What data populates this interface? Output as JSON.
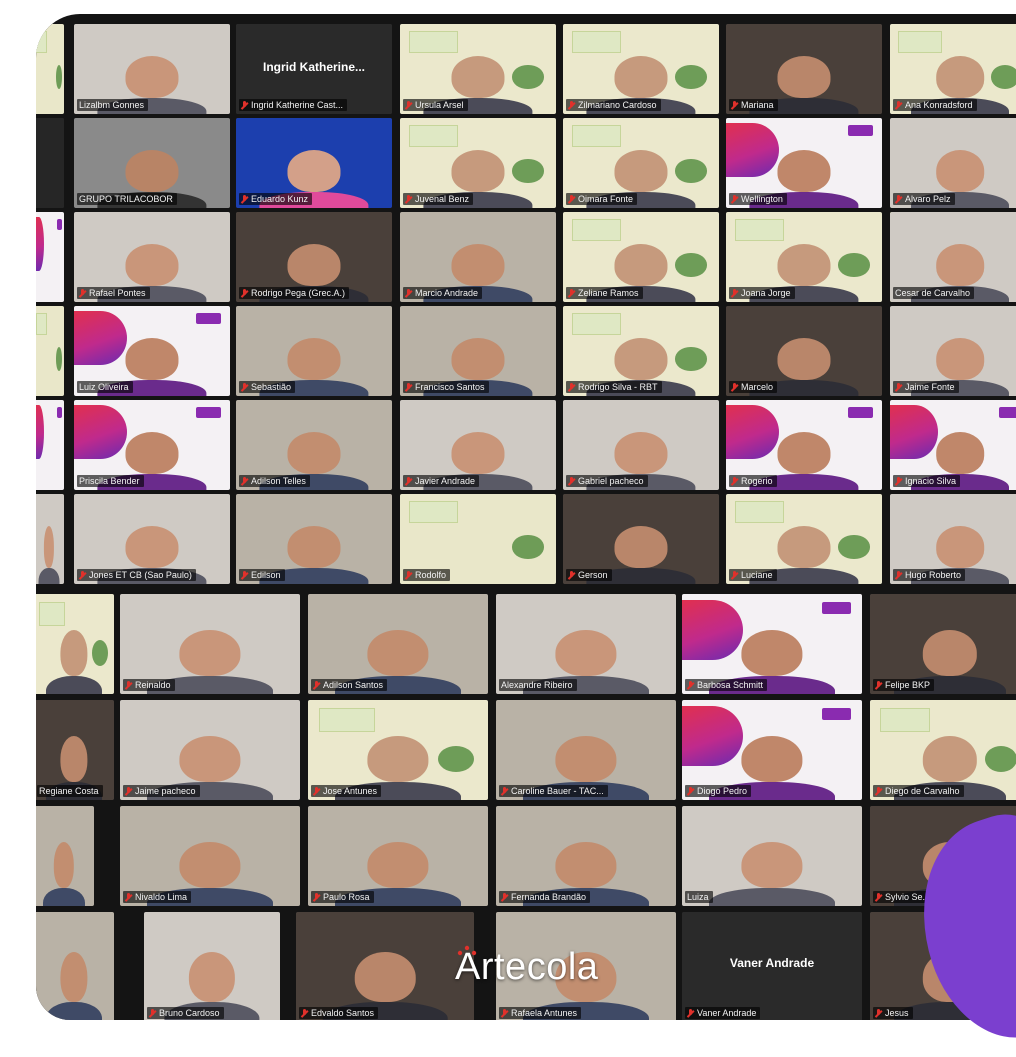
{
  "meeting": {
    "brand_text": "Artecola",
    "accent_color": "#7b3fcf",
    "muted_icon": "muted-mic-icon"
  },
  "participants": [
    {
      "name": "",
      "style": "slide",
      "muted": false
    },
    {
      "name": "Lizalbm Gonnes",
      "style": "face-light",
      "muted": false
    },
    {
      "name": "Ingrid Katherine Cast...",
      "style": "avatar",
      "muted": true,
      "big_name": "Ingrid Katherine..."
    },
    {
      "name": "Ursula Arsel",
      "style": "slide-face",
      "muted": true
    },
    {
      "name": "Zilmariano Cardoso",
      "style": "slide-face",
      "muted": true
    },
    {
      "name": "Mariana",
      "style": "face-dark",
      "muted": true
    },
    {
      "name": "Ana Konradsford",
      "style": "slide-face",
      "muted": true
    },
    {
      "name": "",
      "style": "dark",
      "muted": false
    },
    {
      "name": "GRUPO TRILACOBOR",
      "style": "group",
      "muted": false
    },
    {
      "name": "Eduardo Kunz",
      "style": "blue",
      "muted": true
    },
    {
      "name": "Juvenal Benz",
      "style": "slide-face",
      "muted": true
    },
    {
      "name": "Oimara Fonte",
      "style": "slide-face",
      "muted": true
    },
    {
      "name": "Wellington",
      "style": "art-face",
      "muted": true
    },
    {
      "name": "Alvaro Pelz",
      "style": "face-light",
      "muted": true
    },
    {
      "name": "",
      "style": "art",
      "muted": false
    },
    {
      "name": "Rafael Pontes",
      "style": "face-light",
      "muted": true
    },
    {
      "name": "Rodrigo Pega (Grec.A.)",
      "style": "face-dark",
      "muted": true
    },
    {
      "name": "Marcio Andrade",
      "style": "face-room",
      "muted": true
    },
    {
      "name": "Zeliane Ramos",
      "style": "slide-face",
      "muted": true
    },
    {
      "name": "Joana Jorge",
      "style": "slide-face",
      "muted": true
    },
    {
      "name": "Cesar de Carvalho",
      "style": "face-light",
      "muted": false,
      "speaking": true
    },
    {
      "name": "",
      "style": "slide",
      "muted": false
    },
    {
      "name": "Luiz Oliveira",
      "style": "art-face",
      "muted": false
    },
    {
      "name": "Sebastião",
      "style": "face-room",
      "muted": true
    },
    {
      "name": "Francisco Santos",
      "style": "face-room",
      "muted": true
    },
    {
      "name": "Rodrigo Silva - RBT",
      "style": "slide-face",
      "muted": true
    },
    {
      "name": "Marcelo",
      "style": "face-dark",
      "muted": true
    },
    {
      "name": "Jaime Fonte",
      "style": "face-light",
      "muted": true
    },
    {
      "name": "",
      "style": "art",
      "muted": false
    },
    {
      "name": "Priscila Bender",
      "style": "art-face",
      "muted": false
    },
    {
      "name": "Adilson Telles",
      "style": "face-room",
      "muted": true
    },
    {
      "name": "Javier Andrade",
      "style": "face-light",
      "muted": true
    },
    {
      "name": "Gabriel pacheco",
      "style": "face-light",
      "muted": true
    },
    {
      "name": "Rogerio",
      "style": "art-face",
      "muted": true
    },
    {
      "name": "Ignacio Silva",
      "style": "art-face",
      "muted": true
    },
    {
      "name": "",
      "style": "face-light",
      "muted": false
    },
    {
      "name": "Jones ET CB (Sao Paulo)",
      "style": "face-light",
      "muted": true
    },
    {
      "name": "Edilson",
      "style": "face-room",
      "muted": true
    },
    {
      "name": "Rodolfo",
      "style": "slide",
      "muted": true
    },
    {
      "name": "Gerson",
      "style": "face-dark",
      "muted": true
    },
    {
      "name": "Luciane",
      "style": "slide-face",
      "muted": true
    },
    {
      "name": "Hugo Roberto",
      "style": "face-light",
      "muted": true
    },
    {
      "name": "",
      "style": "slide-face",
      "muted": false
    },
    {
      "name": "Reinaldo",
      "style": "face-light",
      "muted": true
    },
    {
      "name": "Adilson Santos",
      "style": "face-room",
      "muted": true
    },
    {
      "name": "Alexandre Ribeiro",
      "style": "face-light",
      "muted": false
    },
    {
      "name": "Barbosa Schmitt",
      "style": "art-face",
      "muted": true
    },
    {
      "name": "Felipe BKP",
      "style": "face-dark",
      "muted": true
    },
    {
      "name": "Regiane Costa",
      "style": "face-dark",
      "muted": false
    },
    {
      "name": "Jaime pacheco",
      "style": "face-light",
      "muted": true
    },
    {
      "name": "Jose Antunes",
      "style": "slide-face",
      "muted": true
    },
    {
      "name": "Caroline Bauer - TAC...",
      "style": "face-room",
      "muted": true
    },
    {
      "name": "Diogo Pedro",
      "style": "art-face",
      "muted": true
    },
    {
      "name": "Diego de Carvalho",
      "style": "slide-face",
      "muted": true
    },
    {
      "name": "",
      "style": "face-room",
      "muted": false
    },
    {
      "name": "Nivaldo Lima",
      "style": "face-room",
      "muted": true
    },
    {
      "name": "Paulo Rosa",
      "style": "face-room",
      "muted": true
    },
    {
      "name": "Fernanda Brandão",
      "style": "face-room",
      "muted": true
    },
    {
      "name": "Luiza",
      "style": "face-light",
      "muted": false
    },
    {
      "name": "Sylvio Se...",
      "style": "face-dark",
      "muted": true
    },
    {
      "name": "",
      "style": "face-room",
      "muted": false
    },
    {
      "name": "Bruno Cardoso",
      "style": "face-light",
      "muted": true
    },
    {
      "name": "Edvaldo Santos",
      "style": "face-dark",
      "muted": true
    },
    {
      "name": "Rafaela Antunes",
      "style": "face-room",
      "muted": true
    },
    {
      "name": "Vaner Andrade",
      "style": "avatar",
      "muted": true,
      "big_name": "Vaner Andrade"
    },
    {
      "name": "Jesus",
      "style": "face-dark",
      "muted": true
    }
  ]
}
